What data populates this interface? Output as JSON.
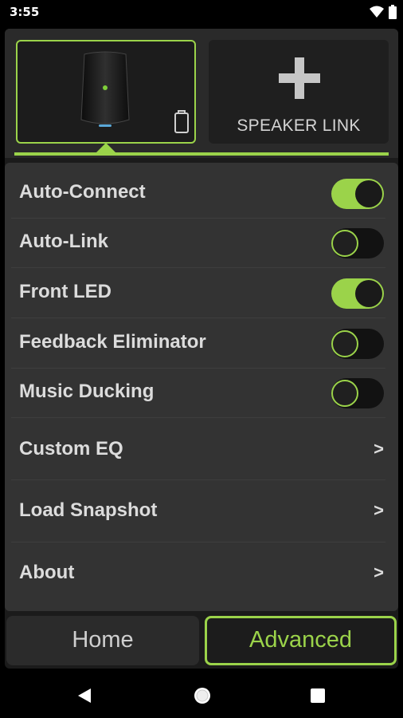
{
  "status_bar": {
    "time": "3:55",
    "icons": [
      "wifi-icon",
      "battery-icon"
    ]
  },
  "speaker_bar": {
    "speaker_icon": "speaker-icon",
    "battery_icon": "battery-icon",
    "link_button": {
      "label": "SPEAKER LINK",
      "icon": "plus-icon"
    }
  },
  "settings": {
    "toggles": [
      {
        "label": "Auto-Connect",
        "on": true
      },
      {
        "label": "Auto-Link",
        "on": false
      },
      {
        "label": "Front LED",
        "on": true
      },
      {
        "label": "Feedback Eliminator",
        "on": false
      },
      {
        "label": "Music Ducking",
        "on": false
      }
    ],
    "links": [
      {
        "label": "Custom EQ",
        "chevron": ">"
      },
      {
        "label": "Load Snapshot",
        "chevron": ">"
      },
      {
        "label": "About",
        "chevron": ">"
      }
    ]
  },
  "tabs": [
    {
      "label": "Home",
      "selected": false
    },
    {
      "label": "Advanced",
      "selected": true
    }
  ],
  "nav_bar": {
    "icons": [
      "back-icon",
      "home-icon",
      "recents-icon"
    ]
  },
  "colors": {
    "accent": "#9bd34a",
    "panel": "#333333",
    "background": "#000000"
  }
}
